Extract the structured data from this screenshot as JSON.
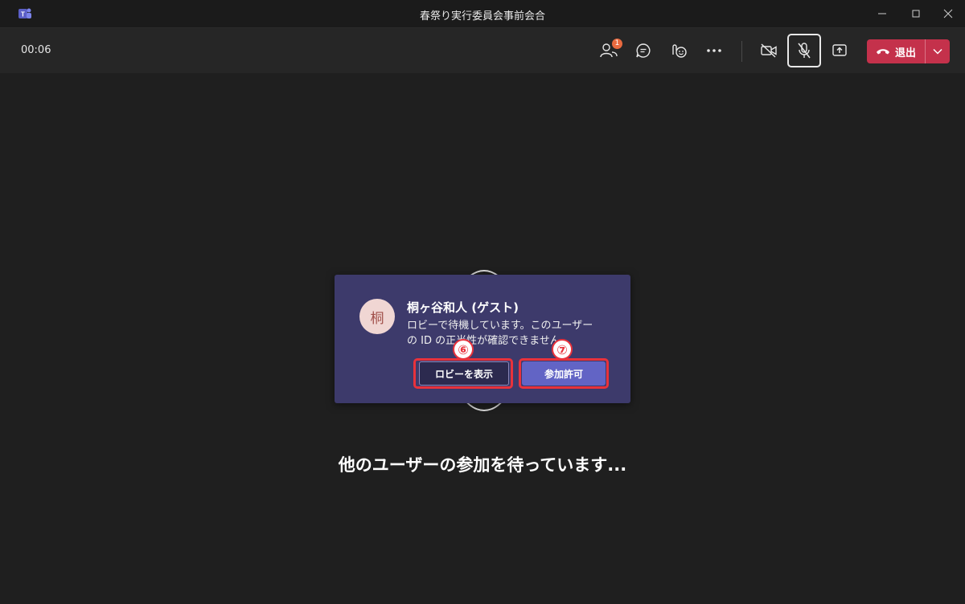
{
  "window": {
    "title": "春祭り実行委員会事前会合",
    "app_icon": "teams-logo-icon"
  },
  "toolbar": {
    "timer": "00:06",
    "people_badge": "1",
    "leave_label": "退出",
    "icons": [
      "people-icon",
      "chat-icon",
      "reactions-icon",
      "more-icon",
      "camera-off-icon",
      "mic-off-icon",
      "share-icon",
      "phone-icon",
      "chevron-down-icon"
    ]
  },
  "stage": {
    "waiting_text": "他のユーザーの参加を待っています..."
  },
  "lobby_notification": {
    "avatar_initial": "桐",
    "guest_name": "桐ヶ谷和人 (ゲスト)",
    "message_line1": "ロビーで待機しています。このユーザー",
    "message_line2": "の ID の正当性が確認できません。",
    "view_lobby_label": "ロビーを表示",
    "admit_label": "参加許可"
  },
  "annotations": {
    "step6": "⑥",
    "step7": "⑦"
  },
  "colors": {
    "leave_button": "#c4314b",
    "admit_button": "#6264c5",
    "card_background": "#3d3a6b",
    "callout": "#e8323c",
    "badge": "#e96a3f"
  }
}
